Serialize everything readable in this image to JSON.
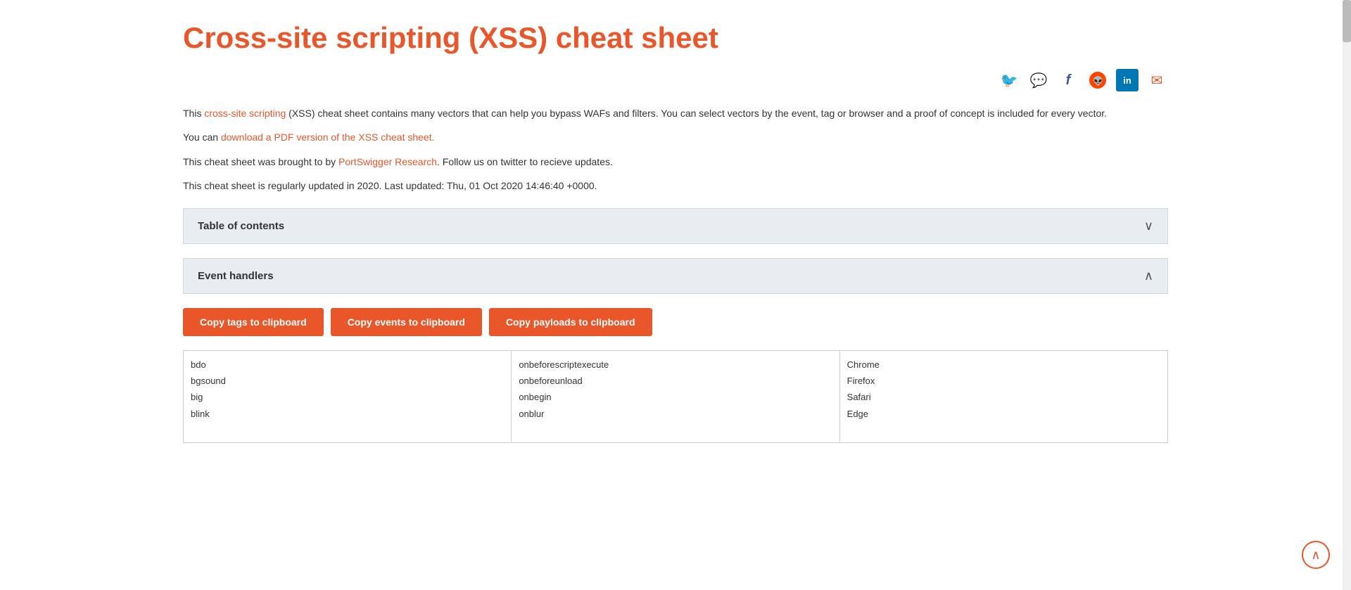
{
  "page": {
    "title": "Cross-site scripting (XSS) cheat sheet",
    "intro": {
      "part1": "This ",
      "link1_text": "cross-site scripting",
      "part2": " (XSS) cheat sheet contains many vectors that can help you bypass WAFs and filters. You can select vectors by the event, tag or browser and a proof of concept is included for every vector.",
      "pdf_prefix": "You can ",
      "pdf_link_text": "download a PDF version of the XSS cheat sheet.",
      "research_prefix": "This cheat sheet was brought to by ",
      "research_link": "PortSwigger Research",
      "research_suffix": ". Follow us on twitter to recieve updates.",
      "updated": "This cheat sheet is regularly updated in 2020. Last updated: Thu, 01 Oct 2020 14:46:40 +0000."
    },
    "social": [
      {
        "name": "twitter",
        "icon": "🐦"
      },
      {
        "name": "whatsapp",
        "icon": "💬"
      },
      {
        "name": "facebook",
        "icon": "f"
      },
      {
        "name": "reddit",
        "icon": "👽"
      },
      {
        "name": "linkedin",
        "icon": "in"
      },
      {
        "name": "email",
        "icon": "✉"
      }
    ],
    "toc": {
      "header": "Table of contents",
      "collapsed": true
    },
    "event_handlers": {
      "header": "Event handlers",
      "collapsed": false,
      "copy_tags_label": "Copy tags to clipboard",
      "copy_events_label": "Copy events to clipboard",
      "copy_payloads_label": "Copy payloads to clipboard",
      "tags_list": [
        "bdo",
        "bgsound",
        "big",
        "blink"
      ],
      "events_list": [
        "onbeforescriptexecute",
        "onbeforeunload",
        "onbegin",
        "onblur"
      ],
      "browsers_list": [
        "Chrome",
        "Firefox",
        "Safari",
        "Edge"
      ]
    }
  }
}
